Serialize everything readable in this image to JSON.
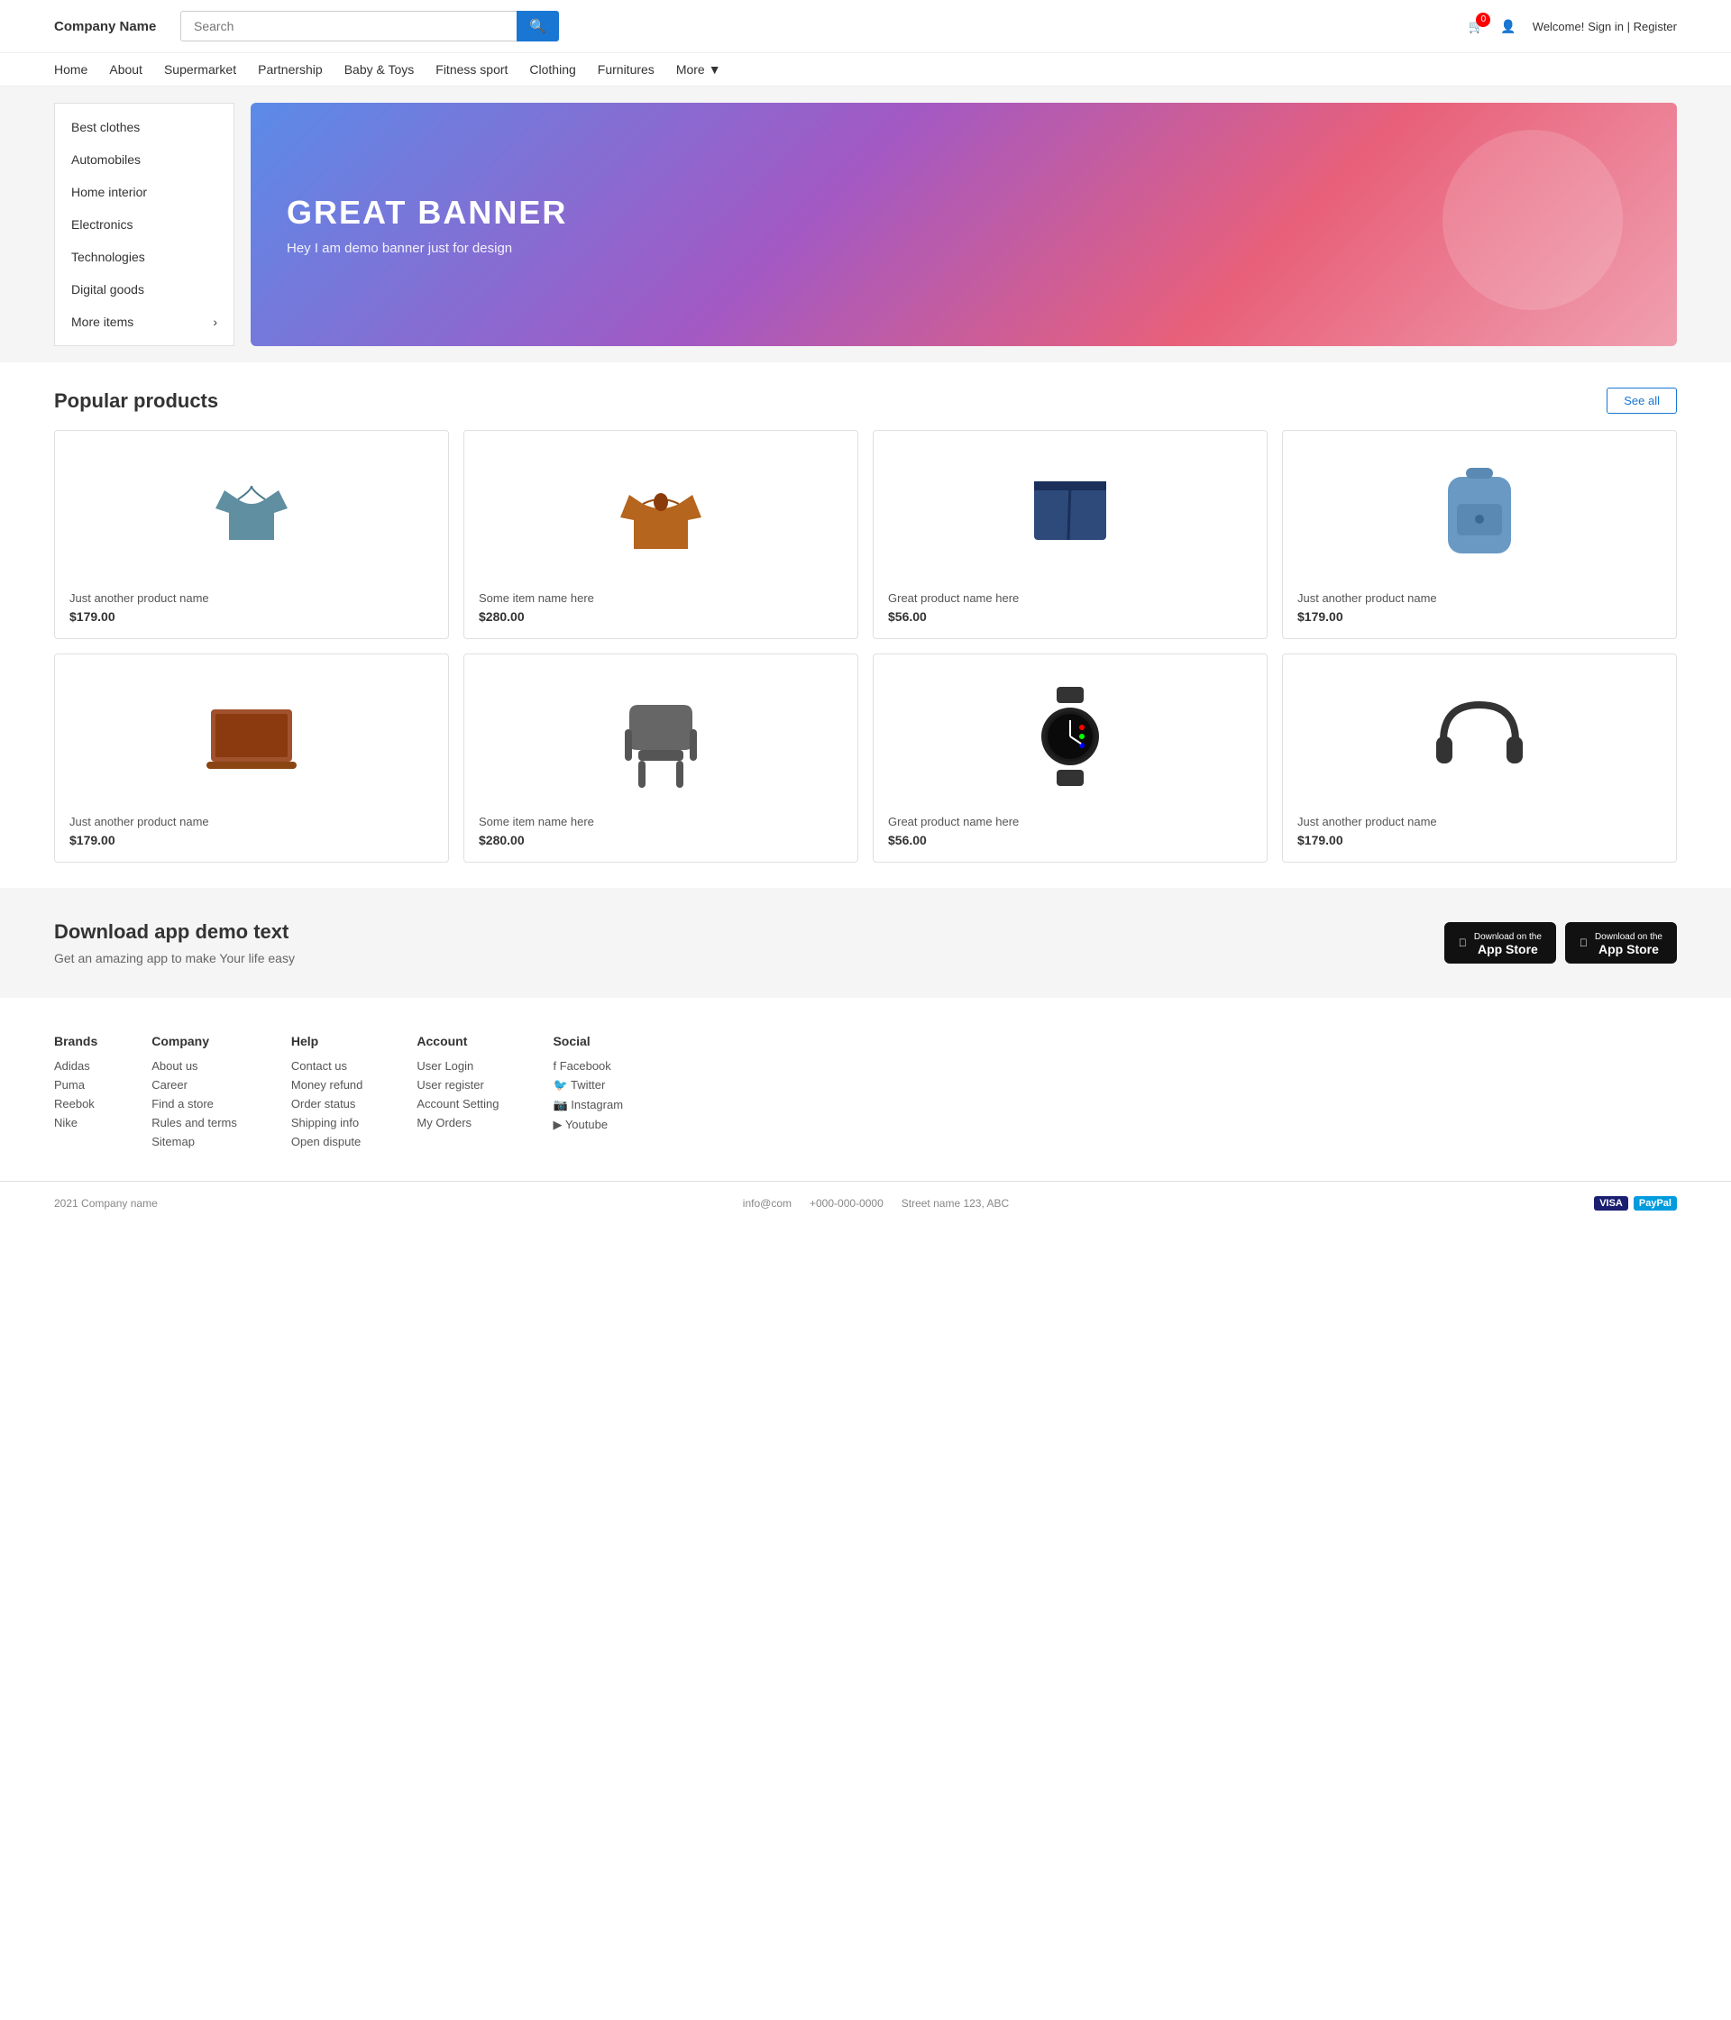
{
  "header": {
    "logo": "Company Name",
    "search_placeholder": "Search",
    "cart_count": "0",
    "welcome_label": "Welcome!",
    "sign_in_label": "Sign in | Register"
  },
  "nav": {
    "items": [
      {
        "label": "Home",
        "id": "home"
      },
      {
        "label": "About",
        "id": "about"
      },
      {
        "label": "Supermarket",
        "id": "supermarket"
      },
      {
        "label": "Partnership",
        "id": "partnership"
      },
      {
        "label": "Baby &amp; Toys",
        "id": "baby-toys"
      },
      {
        "label": "Fitness sport",
        "id": "fitness"
      },
      {
        "label": "Clothing",
        "id": "clothing"
      },
      {
        "label": "Furnitures",
        "id": "furnitures"
      }
    ],
    "more_label": "More"
  },
  "sidebar": {
    "items": [
      {
        "label": "Best clothes",
        "id": "best-clothes"
      },
      {
        "label": "Automobiles",
        "id": "automobiles"
      },
      {
        "label": "Home interior",
        "id": "home-interior"
      },
      {
        "label": "Electronics",
        "id": "electronics"
      },
      {
        "label": "Technologies",
        "id": "technologies"
      },
      {
        "label": "Digital goods",
        "id": "digital-goods"
      },
      {
        "label": "More items",
        "id": "more-items",
        "has_arrow": true
      }
    ]
  },
  "banner": {
    "title": "GREAT BANNER",
    "subtitle": "Hey I am demo banner just for design"
  },
  "popular_products": {
    "section_title": "Popular products",
    "see_all_label": "See all",
    "products": [
      {
        "name": "Just another product name",
        "price": "$179.00",
        "type": "polo"
      },
      {
        "name": "Some item name here",
        "price": "$280.00",
        "type": "jacket"
      },
      {
        "name": "Great product name here",
        "price": "$56.00",
        "type": "shorts"
      },
      {
        "name": "Just another product name",
        "price": "$179.00",
        "type": "backpack"
      },
      {
        "name": "Just another product name",
        "price": "$179.00",
        "type": "laptop"
      },
      {
        "name": "Some item name here",
        "price": "$280.00",
        "type": "chair"
      },
      {
        "name": "Great product name here",
        "price": "$56.00",
        "type": "watch"
      },
      {
        "name": "Just another product name",
        "price": "$179.00",
        "type": "headphones"
      }
    ]
  },
  "app_section": {
    "title": "Download app demo text",
    "subtitle": "Get an amazing app to make Your life easy",
    "btn1_small": "Download on the",
    "btn1_main": "App Store",
    "btn2_small": "Download on the",
    "btn2_main": "App Store"
  },
  "footer": {
    "brands": {
      "title": "Brands",
      "links": [
        "Adidas",
        "Puma",
        "Reebok",
        "Nike"
      ]
    },
    "company": {
      "title": "Company",
      "links": [
        "About us",
        "Career",
        "Find a store",
        "Rules and terms",
        "Sitemap"
      ]
    },
    "help": {
      "title": "Help",
      "links": [
        "Contact us",
        "Money refund",
        "Order status",
        "Shipping info",
        "Open dispute"
      ]
    },
    "account": {
      "title": "Account",
      "links": [
        "User Login",
        "User register",
        "Account Setting",
        "My Orders"
      ]
    },
    "social": {
      "title": "Social",
      "links": [
        {
          "label": "Facebook",
          "icon": "facebook"
        },
        {
          "label": "Twitter",
          "icon": "twitter"
        },
        {
          "label": "Instagram",
          "icon": "instagram"
        },
        {
          "label": "Youtube",
          "icon": "youtube"
        }
      ]
    }
  },
  "footer_bottom": {
    "copyright": "2021 Company name",
    "email": "info@com",
    "phone": "+000-000-0000",
    "address": "Street name 123, ABC"
  }
}
